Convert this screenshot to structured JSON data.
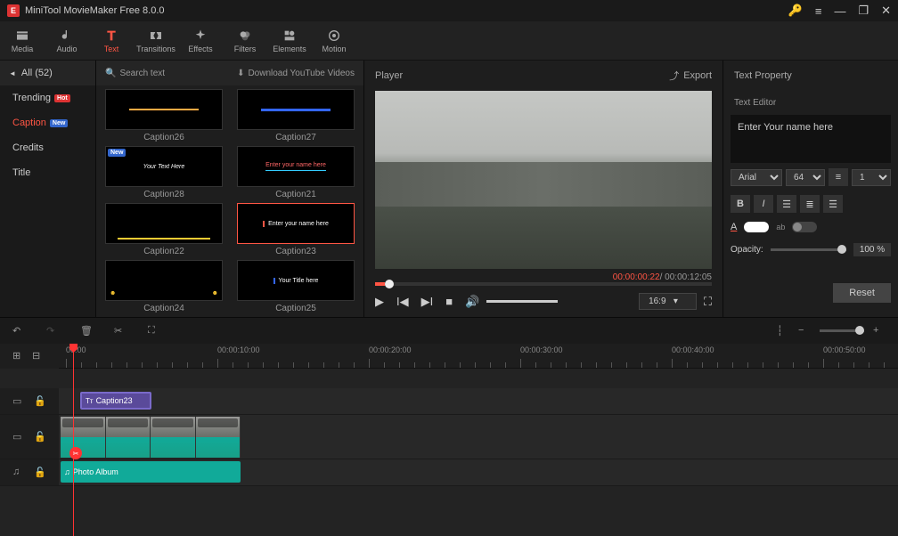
{
  "app": {
    "title": "MiniTool MovieMaker Free 8.0.0"
  },
  "toolbar": [
    {
      "id": "media",
      "label": "Media"
    },
    {
      "id": "audio",
      "label": "Audio"
    },
    {
      "id": "text",
      "label": "Text"
    },
    {
      "id": "transitions",
      "label": "Transitions"
    },
    {
      "id": "effects",
      "label": "Effects"
    },
    {
      "id": "filters",
      "label": "Filters"
    },
    {
      "id": "elements",
      "label": "Elements"
    },
    {
      "id": "motion",
      "label": "Motion"
    }
  ],
  "sidebar": {
    "header": "All (52)",
    "items": [
      {
        "label": "Trending",
        "badge": "Hot",
        "cls": "hot"
      },
      {
        "label": "Caption",
        "badge": "New",
        "cls": "new",
        "active": true
      },
      {
        "label": "Credits"
      },
      {
        "label": "Title"
      }
    ]
  },
  "gallery": {
    "search": "Search text",
    "download": "Download YouTube Videos",
    "items": [
      {
        "label": "Caption26"
      },
      {
        "label": "Caption27"
      },
      {
        "label": "Caption28",
        "inner": "Your Text Here"
      },
      {
        "label": "Caption21",
        "inner": "Enter your name here"
      },
      {
        "label": "Caption22"
      },
      {
        "label": "Caption23",
        "inner": "Enter your name here",
        "selected": true
      },
      {
        "label": "Caption24"
      },
      {
        "label": "Caption25",
        "inner": "Your Title here"
      }
    ]
  },
  "player": {
    "title": "Player",
    "export": "Export",
    "current": "00:00:00:22",
    "total": " / 00:00:12:05",
    "aspect": "16:9"
  },
  "textprop": {
    "title": "Text Property",
    "editor_label": "Text Editor",
    "text": "Enter Your name here",
    "font": "Arial",
    "size": "64",
    "line": "1",
    "opacity_label": "Opacity:",
    "opacity": "100 %",
    "reset": "Reset"
  },
  "ruler": [
    "00:00",
    "00:00:10:00",
    "00:00:20:00",
    "00:00:30:00",
    "00:00:40:00",
    "00:00:50:00"
  ],
  "clips": {
    "caption": "Caption23",
    "audio": "Photo Album"
  }
}
